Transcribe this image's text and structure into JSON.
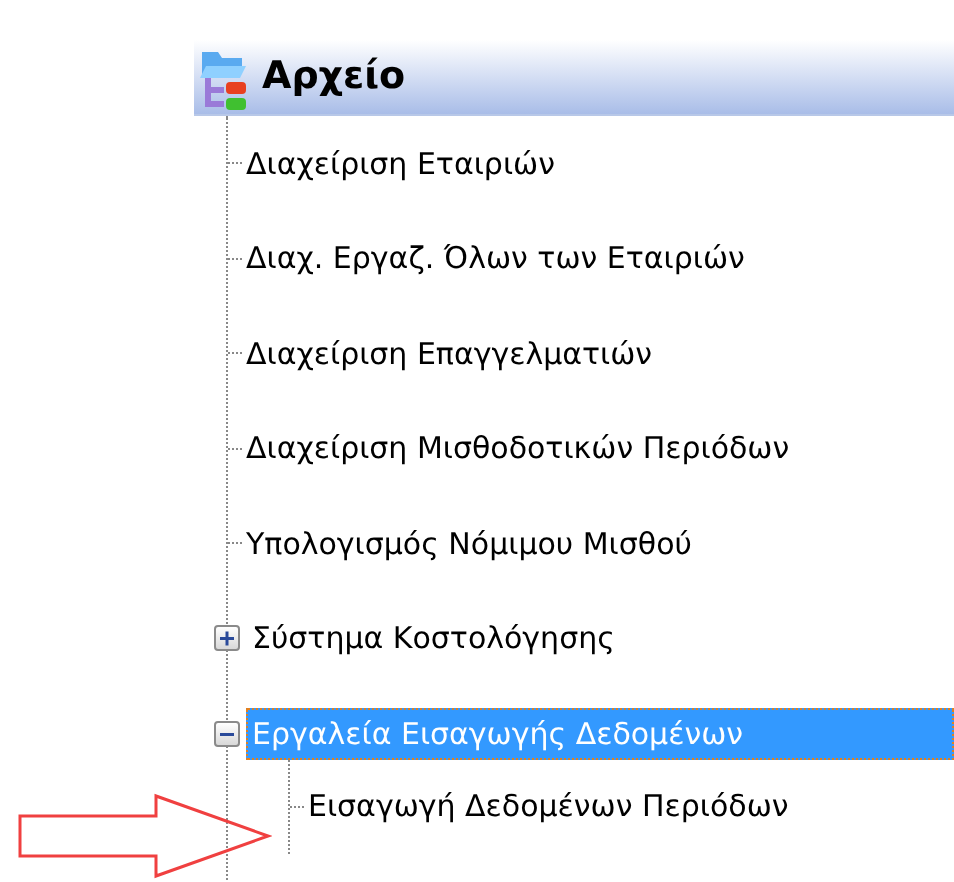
{
  "tree": {
    "title": "Αρχείο",
    "items": [
      {
        "label": "Διαχείριση Εταιριών",
        "selected": false
      },
      {
        "label": "Διαχ. Εργαζ. Όλων των Εταιριών",
        "selected": false
      },
      {
        "label": "Διαχείριση Επαγγελματιών",
        "selected": false
      },
      {
        "label": "Διαχείριση Μισθοδοτικών Περιόδων",
        "selected": false
      },
      {
        "label": "Υπολογισμός Νόμιμου Μισθού",
        "selected": false
      },
      {
        "label": "Σύστημα Κοστολόγησης",
        "selected": false,
        "expanded": false
      },
      {
        "label": "Εργαλεία Εισαγωγής Δεδομένων",
        "selected": true,
        "expanded": true,
        "children": [
          {
            "label": "Εισαγωγή Δεδομένων Περιόδων",
            "selected": false
          }
        ]
      }
    ]
  }
}
